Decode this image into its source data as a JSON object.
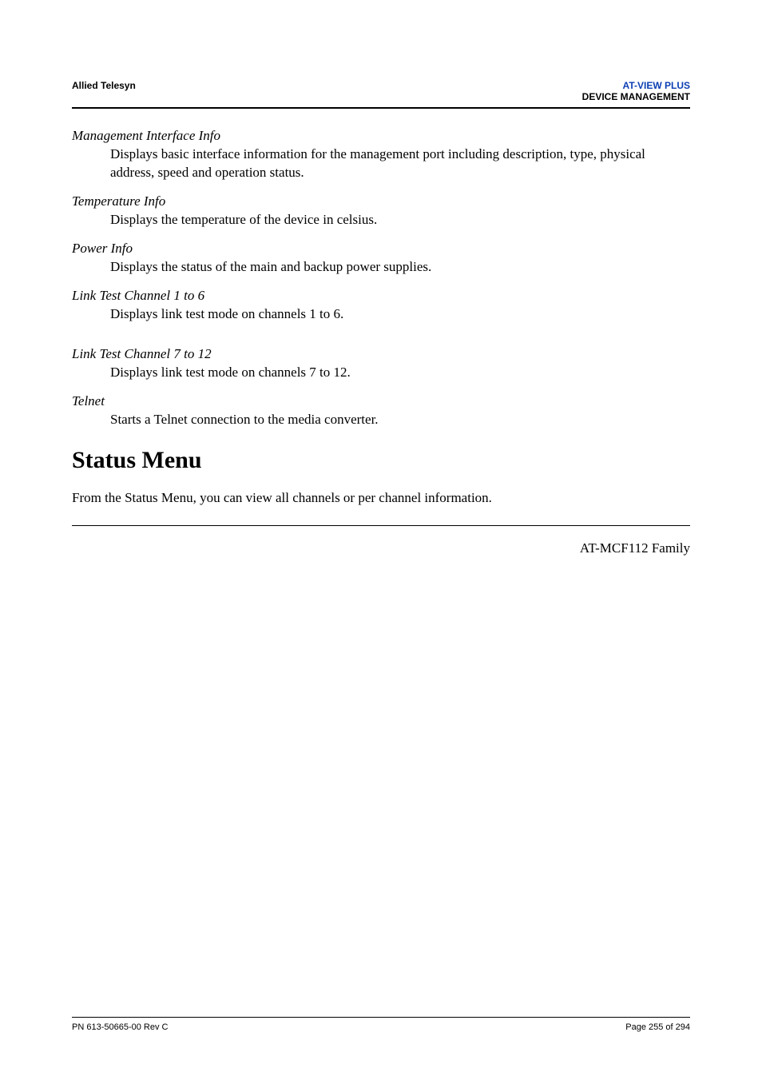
{
  "header": {
    "left": "Allied Telesyn",
    "right_line1": "AT-VIEW PLUS",
    "right_line2": "DEVICE MANAGEMENT"
  },
  "sections": {
    "mgmt_iface": {
      "title": "Management Interface Info",
      "body": "Displays basic interface information for the management port including description, type, physical address, speed and operation status."
    },
    "temp": {
      "title": "Temperature Info",
      "body": "Displays the temperature of the device in celsius."
    },
    "power": {
      "title": "Power Info",
      "body": "Displays the status of the main and backup power supplies."
    },
    "ltc1": {
      "title": "Link Test Channel 1 to 6",
      "body": "Displays link test mode on channels 1 to 6."
    },
    "ltc7": {
      "title": "Link Test Channel 7 to 12",
      "body": "Displays link test mode on channels 7 to 12."
    },
    "telnet": {
      "title": "Telnet",
      "body": "Starts a Telnet connection to the media converter."
    }
  },
  "status_menu": {
    "heading": "Status Menu",
    "intro": "From the Status Menu, you can view all channels or per channel information.",
    "family_label": "AT-MCF112 Family"
  },
  "footer": {
    "left": "PN 613-50665-00 Rev C",
    "right": "Page 255 of 294"
  }
}
